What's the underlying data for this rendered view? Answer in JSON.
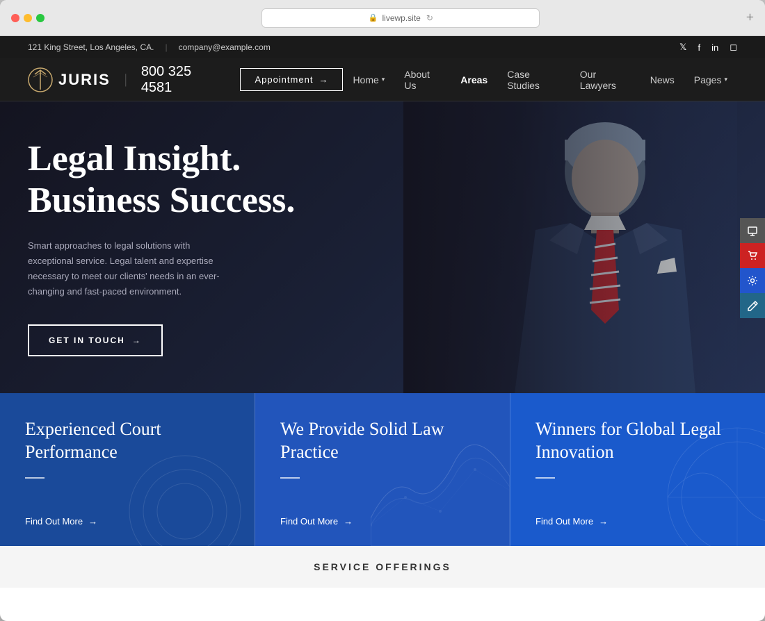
{
  "browser": {
    "url": "livewp.site",
    "refresh_icon": "↻",
    "plus_label": "+"
  },
  "top_bar": {
    "address": "121 King Street, Los Angeles, CA.",
    "email": "company@example.com",
    "socials": [
      "𝕏",
      "f",
      "in",
      "◻"
    ]
  },
  "navbar": {
    "logo_text": "JURIS",
    "phone": "800 325 4581",
    "appointment_label": "Appointment",
    "appointment_arrow": "→",
    "nav_items": [
      {
        "label": "Home",
        "has_dropdown": true,
        "active": false
      },
      {
        "label": "About Us",
        "has_dropdown": false,
        "active": false
      },
      {
        "label": "Areas",
        "has_dropdown": false,
        "active": true
      },
      {
        "label": "Case Studies",
        "has_dropdown": false,
        "active": false
      },
      {
        "label": "Our Lawyers",
        "has_dropdown": false,
        "active": false
      },
      {
        "label": "News",
        "has_dropdown": false,
        "active": false
      },
      {
        "label": "Pages",
        "has_dropdown": true,
        "active": false
      }
    ]
  },
  "hero": {
    "title_line1": "Legal Insight.",
    "title_line2": "Business Success.",
    "subtitle": "Smart approaches to legal solutions with exceptional service. Legal talent and expertise necessary to meet our clients' needs in an ever-changing and fast-paced environment.",
    "cta_label": "GET IN TOUCH",
    "cta_arrow": "→"
  },
  "scroll_dots": [
    {
      "active": true
    },
    {
      "active": false
    }
  ],
  "sidebar_tools": [
    {
      "icon": "⬛",
      "color": "gray"
    },
    {
      "icon": "🛒",
      "color": "red"
    },
    {
      "icon": "⚙",
      "color": "blue"
    },
    {
      "icon": "✎",
      "color": "teal"
    }
  ],
  "feature_cards": [
    {
      "title": "Experienced Court Performance",
      "link_label": "Find Out More",
      "link_arrow": "→",
      "bg_color": "card-blue-dark"
    },
    {
      "title": "We Provide Solid Law Practice",
      "link_label": "Find Out More",
      "link_arrow": "→",
      "bg_color": "card-blue-mid"
    },
    {
      "title": "Winners for Global Legal Innovation",
      "link_label": "Find Out More",
      "link_arrow": "→",
      "bg_color": "card-blue-bright"
    }
  ],
  "service_bar": {
    "label": "SERVICE OFFERINGS"
  }
}
